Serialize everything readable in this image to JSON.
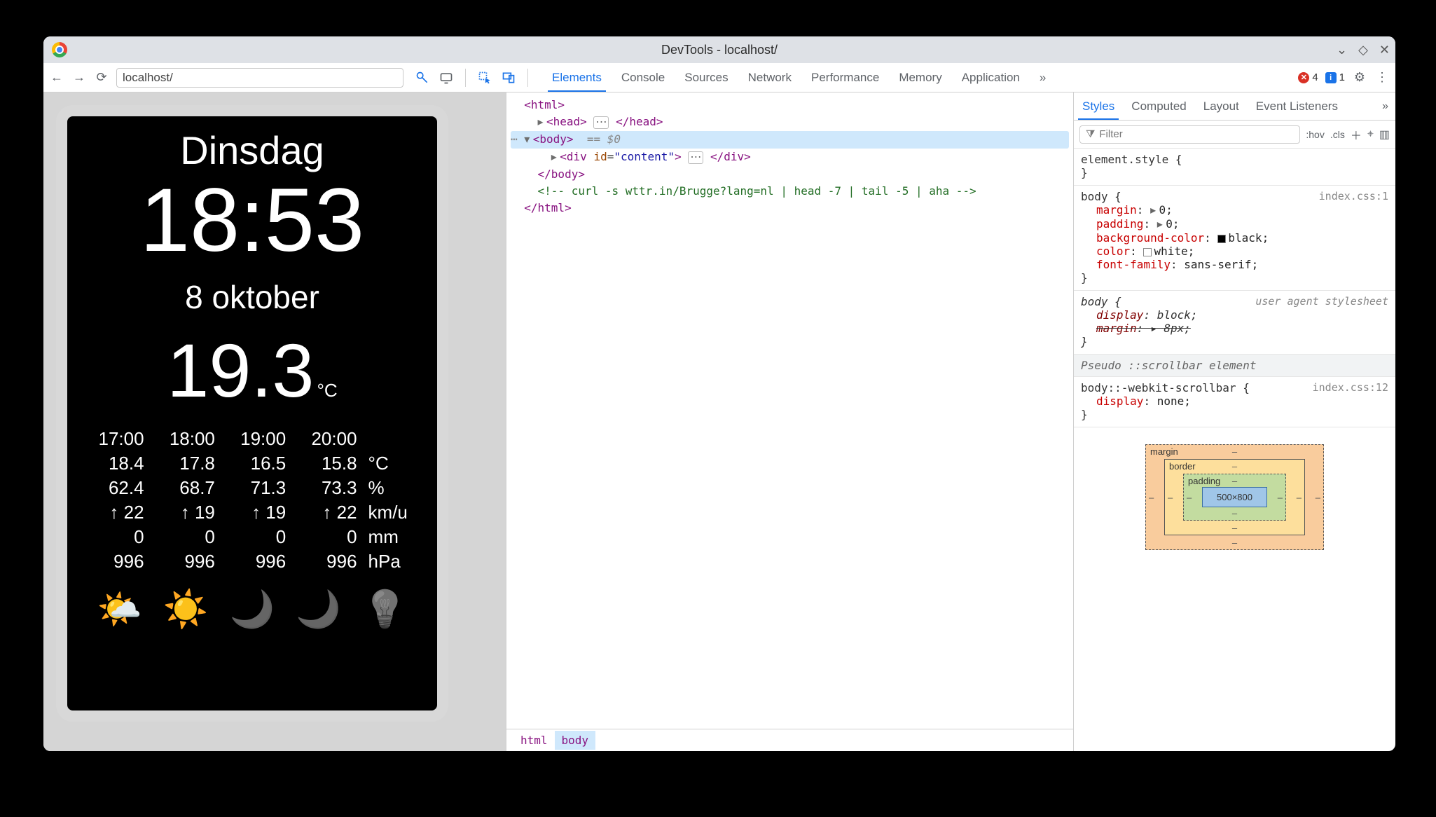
{
  "window": {
    "title": "DevTools - localhost/",
    "url": "localhost/"
  },
  "devtools": {
    "tabs": [
      "Elements",
      "Console",
      "Sources",
      "Network",
      "Performance",
      "Memory",
      "Application"
    ],
    "tabs_active": "Elements",
    "more_label": "»",
    "errors_count": "4",
    "info_count": "1"
  },
  "styles_panel": {
    "tabs": [
      "Styles",
      "Computed",
      "Layout",
      "Event Listeners"
    ],
    "tabs_active": "Styles",
    "more_label": "»",
    "filter_placeholder": "Filter",
    "toggles": {
      "hov": ":hov",
      "cls": ".cls"
    }
  },
  "dom": {
    "l0": "<html>",
    "l1_open": "<head>",
    "l1_close": "</head>",
    "l2_open": "<body>",
    "l2_hint": "== $0",
    "l3_open": "<div ",
    "l3_attr_name": "id",
    "l3_attr_val": "\"content\"",
    "l3_mid": ">",
    "l3_close": "</div>",
    "l4": "</body>",
    "l5": "<!-- curl -s wttr.in/Brugge?lang=nl | head -7 | tail -5 | aha -->",
    "l6": "</html>",
    "breadcrumb": [
      "html",
      "body"
    ]
  },
  "rules": {
    "r0_sel": "element.style {",
    "r1_sel": "body {",
    "r1_src": "index.css:1",
    "r1_p0_n": "margin",
    "r1_p0_v": "0",
    "r1_p1_n": "padding",
    "r1_p1_v": "0",
    "r1_p2_n": "background-color",
    "r1_p2_v": "black",
    "r1_p3_n": "color",
    "r1_p3_v": "white",
    "r1_p4_n": "font-family",
    "r1_p4_v": "sans-serif",
    "r2_sel": "body {",
    "r2_src": "user agent stylesheet",
    "r2_p0_n": "display",
    "r2_p0_v": "block",
    "r2_p1_n": "margin",
    "r2_p1_v": "8px",
    "pseudo_head": "Pseudo ::scrollbar element",
    "r3_sel": "body::-webkit-scrollbar {",
    "r3_src": "index.css:12",
    "r3_p0_n": "display",
    "r3_p0_v": "none",
    "close_brace": "}"
  },
  "boxmodel": {
    "margin_label": "margin",
    "border_label": "border",
    "padding_label": "padding",
    "content": "500×800",
    "dash": "–"
  },
  "page": {
    "day": "Dinsdag",
    "time": "18:53",
    "date": "8 oktober",
    "temp_value": "19.3",
    "temp_unit": "°C",
    "forecast": {
      "hours": [
        "17:00",
        "18:00",
        "19:00",
        "20:00"
      ],
      "temp": [
        "18.4",
        "17.8",
        "16.5",
        "15.8"
      ],
      "temp_unit": "°C",
      "hum": [
        "62.4",
        "68.7",
        "71.3",
        "73.3"
      ],
      "hum_unit": "%",
      "wind": [
        "↑ 22",
        "↑ 19",
        "↑ 19",
        "↑ 22"
      ],
      "wind_unit": "km/u",
      "precip": [
        "0",
        "0",
        "0",
        "0"
      ],
      "precip_unit": "mm",
      "press": [
        "996",
        "996",
        "996",
        "996"
      ],
      "press_unit": "hPa"
    },
    "icons": [
      "🌤️",
      "☀️",
      "🌙",
      "🌙",
      "💡"
    ]
  }
}
